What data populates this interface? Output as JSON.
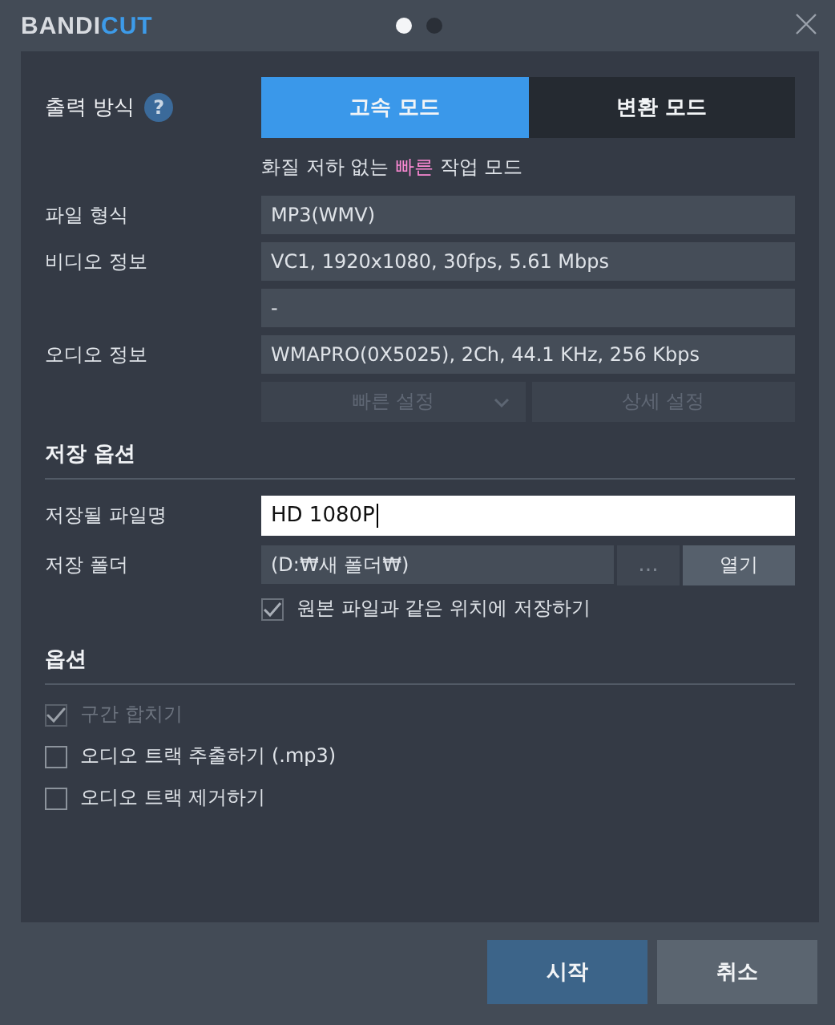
{
  "logo": {
    "main": "BANDI",
    "accent": "CUT"
  },
  "pager": [
    {
      "selected": true
    },
    {
      "selected": false
    }
  ],
  "output": {
    "label": "출력 방식",
    "help": "?",
    "modes": [
      {
        "label": "고속 모드",
        "selected": true
      },
      {
        "label": "변환 모드",
        "selected": false
      }
    ],
    "description": [
      {
        "text": "화질 저하 없는 ",
        "highlight": false
      },
      {
        "text": "빠른",
        "highlight": true
      },
      {
        "text": " 작업 모드",
        "highlight": false
      }
    ]
  },
  "info_rows": [
    {
      "label": "파일 형식",
      "value": "MP3(WMV)"
    },
    {
      "label": "비디오 정보",
      "value": "VC1, 1920x1080, 30fps, 5.61 Mbps"
    },
    {
      "value": "-"
    },
    {
      "label": "오디오 정보",
      "value": "WMAPRO(0X5025), 2Ch, 44.1 KHz, 256 Kbps"
    }
  ],
  "setting_buttons": [
    {
      "label": "빠른 설정",
      "dropdown": true,
      "disabled": true
    },
    {
      "label": "상세 설정",
      "dropdown": false,
      "disabled": true
    }
  ],
  "save": {
    "title": "저장 옵션",
    "filename_label": "저장될 파일명",
    "filename": "HD 1080P",
    "folder_label": "저장 폴더",
    "folder": "(D:₩새 폴더₩)",
    "browse": "...",
    "open": "열기",
    "same_location": {
      "label": "원본 파일과 같은 위치에 저장하기",
      "checked": true,
      "disabled": false
    }
  },
  "options": {
    "title": "옵션",
    "items": [
      {
        "label": "구간 합치기",
        "checked": true,
        "disabled": true
      },
      {
        "label": "오디오 트랙 추출하기 (.mp3)",
        "checked": false,
        "disabled": false
      },
      {
        "label": "오디오 트랙 제거하기",
        "checked": false,
        "disabled": false
      }
    ]
  },
  "footer": [
    {
      "label": "시작",
      "kind": "primary"
    },
    {
      "label": "취소",
      "kind": "secondary"
    }
  ]
}
